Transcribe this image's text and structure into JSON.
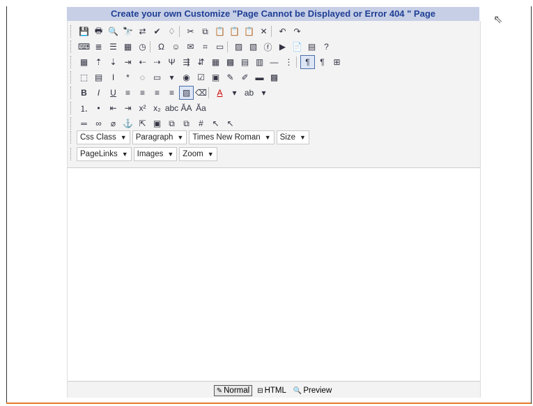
{
  "banner_title": "Create your own Customize \"Page Cannot be Displayed or Error 404 \" Page",
  "colors": {
    "banner_bg": "#c7cfe6",
    "banner_text": "#1f3f95",
    "accent_line": "#e87a2a"
  },
  "toolbar_rows": [
    [
      "save-icon",
      "print-icon",
      "preview-icon",
      "find-icon",
      "find-replace-icon",
      "spellcheck-icon",
      "spelling-abc-icon",
      "|",
      "cut-icon",
      "copy-icon",
      "paste-icon",
      "paste-text-icon",
      "paste-word-icon",
      "delete-icon",
      "|",
      "undo-icon",
      "redo-icon"
    ],
    [
      "insert-code-icon",
      "insert-list-icon",
      "insert-rule-icon",
      "insert-date-icon",
      "insert-time-icon",
      "|",
      "special-char-icon",
      "emoticon-icon",
      "insert-snippet-icon",
      "insert-form-icon",
      "insert-template-icon",
      "|",
      "insert-image-icon",
      "image-gallery-icon",
      "insert-flash-icon",
      "insert-media-icon",
      "insert-document-icon",
      "insert-anchor-list-icon",
      "help-icon"
    ],
    [
      "insert-table-icon",
      "insert-row-above-icon",
      "insert-row-below-icon",
      "delete-row-icon",
      "insert-col-left-icon",
      "insert-col-right-icon",
      "delete-col-icon",
      "merge-right-icon",
      "merge-down-icon",
      "table-properties-icon",
      "cell-properties-icon",
      "split-cell-icon",
      "split-row-icon",
      "hr-dash-icon",
      "split-col-icon",
      "|",
      "ltr-icon",
      "rtl-icon",
      "show-borders-icon"
    ],
    [
      "form-icon",
      "textarea-icon",
      "textbox-icon",
      "password-icon",
      "hidden-field-icon",
      "submit-button-icon",
      "select-list-icon",
      "radio-icon",
      "checkbox-icon",
      "image-button-icon",
      "highlight-icon",
      "underline-color-icon",
      "horizontal-line-icon",
      "page-properties-icon"
    ],
    [
      "bold-icon",
      "italic-icon",
      "underline-icon",
      "align-left-icon",
      "align-center-icon",
      "align-right-icon",
      "justify-icon",
      "absolute-position-icon",
      "eraser-icon",
      "|",
      "font-color-icon",
      "dropdown-icon",
      "highlight-color-icon",
      "dropdown-icon"
    ],
    [
      "ordered-list-icon",
      "unordered-list-icon",
      "outdent-icon",
      "indent-icon",
      "superscript-icon",
      "subscript-icon",
      "strikethrough-icon",
      "case-upper-icon",
      "case-lower-icon"
    ],
    [
      "line-icon",
      "link-icon",
      "unlink-icon",
      "anchor-icon",
      "select-element-icon",
      "image-map-icon",
      "bring-forward-icon",
      "send-backward-icon",
      "grid-icon",
      "select-all-icon",
      "pointer-icon"
    ]
  ],
  "glyphs": {
    "save-icon": "💾",
    "print-icon": "🖶",
    "preview-icon": "🔍",
    "find-icon": "🔭",
    "find-replace-icon": "⇄",
    "spellcheck-icon": "✔",
    "spelling-abc-icon": "♢",
    "cut-icon": "✂",
    "copy-icon": "⧉",
    "paste-icon": "📋",
    "paste-text-icon": "📋",
    "paste-word-icon": "📋",
    "delete-icon": "✕",
    "undo-icon": "↶",
    "redo-icon": "↷",
    "insert-code-icon": "⌨",
    "insert-list-icon": "≣",
    "insert-rule-icon": "☰",
    "insert-date-icon": "▦",
    "insert-time-icon": "◷",
    "special-char-icon": "Ω",
    "emoticon-icon": "☺",
    "insert-snippet-icon": "✉",
    "insert-form-icon": "⌗",
    "insert-template-icon": "▭",
    "insert-image-icon": "▨",
    "image-gallery-icon": "▧",
    "insert-flash-icon": "ⓕ",
    "insert-media-icon": "▶",
    "insert-document-icon": "📄",
    "insert-anchor-list-icon": "▤",
    "help-icon": "?",
    "insert-table-icon": "▦",
    "insert-row-above-icon": "⇡",
    "insert-row-below-icon": "⇣",
    "delete-row-icon": "⇥",
    "insert-col-left-icon": "⇠",
    "insert-col-right-icon": "⇢",
    "delete-col-icon": "Ψ",
    "merge-right-icon": "⇶",
    "merge-down-icon": "⇵",
    "table-properties-icon": "▦",
    "cell-properties-icon": "▩",
    "split-cell-icon": "▤",
    "split-row-icon": "▥",
    "hr-dash-icon": "—",
    "split-col-icon": "⋮",
    "ltr-icon": "¶",
    "rtl-icon": "¶",
    "show-borders-icon": "⊞",
    "form-icon": "⬚",
    "textarea-icon": "▤",
    "textbox-icon": "I",
    "password-icon": "*",
    "hidden-field-icon": "◌",
    "submit-button-icon": "▭",
    "select-list-icon": "▾",
    "radio-icon": "◉",
    "checkbox-icon": "☑",
    "image-button-icon": "▣",
    "highlight-icon": "✎",
    "underline-color-icon": "✐",
    "horizontal-line-icon": "▬",
    "page-properties-icon": "▩",
    "bold-icon": "B",
    "italic-icon": "I",
    "underline-icon": "U",
    "align-left-icon": "≡",
    "align-center-icon": "≡",
    "align-right-icon": "≡",
    "justify-icon": "≡",
    "absolute-position-icon": "▨",
    "eraser-icon": "⌫",
    "font-color-icon": "A",
    "dropdown-icon": "▾",
    "highlight-color-icon": "ab",
    "ordered-list-icon": "⒈",
    "unordered-list-icon": "•",
    "outdent-icon": "⇤",
    "indent-icon": "⇥",
    "superscript-icon": "x²",
    "subscript-icon": "x₂",
    "strikethrough-icon": "abc",
    "case-upper-icon": "ĂA",
    "case-lower-icon": "Ăa",
    "line-icon": "═",
    "link-icon": "∞",
    "unlink-icon": "⌀",
    "anchor-icon": "⚓",
    "select-element-icon": "⇱",
    "image-map-icon": "▣",
    "bring-forward-icon": "⧉",
    "send-backward-icon": "⧉",
    "grid-icon": "#",
    "select-all-icon": "↖",
    "pointer-icon": "↖"
  },
  "dropdowns_row1": [
    {
      "name": "css-class-dropdown",
      "label": "Css Class"
    },
    {
      "name": "paragraph-dropdown",
      "label": "Paragraph"
    },
    {
      "name": "font-name-dropdown",
      "label": "Times New Roman"
    },
    {
      "name": "font-size-dropdown",
      "label": "Size"
    }
  ],
  "dropdowns_row2": [
    {
      "name": "pagelinks-dropdown",
      "label": "PageLinks"
    },
    {
      "name": "images-dropdown",
      "label": "Images"
    },
    {
      "name": "zoom-dropdown",
      "label": "Zoom"
    }
  ],
  "modes": [
    {
      "name": "mode-normal",
      "icon": "✎",
      "label": "Normal",
      "active": true
    },
    {
      "name": "mode-html",
      "icon": "⊟",
      "label": "HTML",
      "active": false
    },
    {
      "name": "mode-preview",
      "icon": "🔍",
      "label": "Preview",
      "active": false
    }
  ]
}
